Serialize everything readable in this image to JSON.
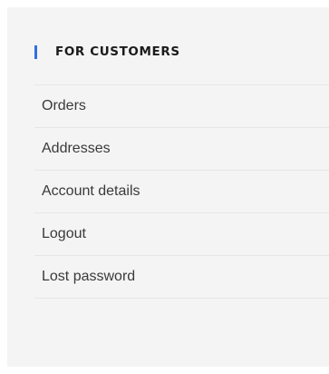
{
  "section": {
    "heading": "FOR CUSTOMERS",
    "accent_color": "#2f6fe8"
  },
  "menu": {
    "items": [
      {
        "label": "Orders"
      },
      {
        "label": "Addresses"
      },
      {
        "label": "Account details"
      },
      {
        "label": "Logout"
      },
      {
        "label": "Lost password"
      }
    ]
  }
}
